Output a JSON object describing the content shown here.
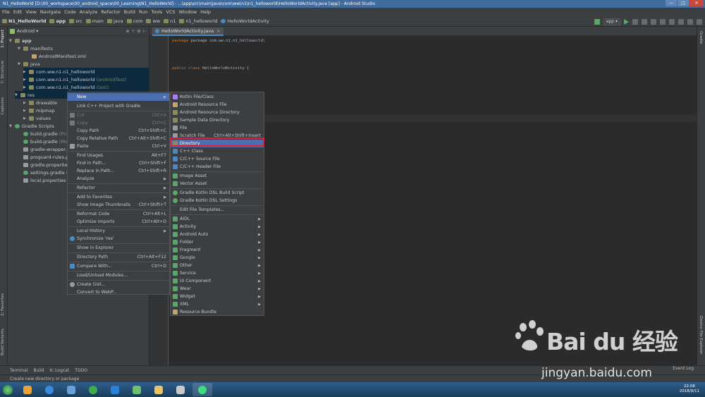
{
  "window": {
    "title": "N1_HelloWorld [D:\\00_workspace\\00_android_space\\00_Learning\\N1_HelloWorld] - ...\\app\\src\\main\\java\\com\\ww\\n1\\n1_helloworld\\HelloWorldActivity.java [app] - Android Studio",
    "controls": [
      "—",
      "□",
      "✕"
    ]
  },
  "menubar": [
    "File",
    "Edit",
    "View",
    "Navigate",
    "Code",
    "Analyze",
    "Refactor",
    "Build",
    "Run",
    "Tools",
    "VCS",
    "Window",
    "Help"
  ],
  "navbar": {
    "crumbs": [
      "N1_HelloWorld",
      "app",
      "src",
      "main",
      "java",
      "com",
      "ww",
      "n1",
      "n1_helloworld",
      "HelloWorldActivity"
    ],
    "run_config": "app"
  },
  "project": {
    "view": "Android",
    "tree": [
      {
        "label": "app"
      },
      {
        "label": "manifests"
      },
      {
        "label": "AndroidManifest.xml"
      },
      {
        "label": "java"
      },
      {
        "label": "com.ww.n1.n1_helloworld",
        "suffix": ""
      },
      {
        "label": "com.ww.n1.n1_helloworld",
        "suffix": "(androidTest)"
      },
      {
        "label": "com.ww.n1.n1_helloworld",
        "suffix": "(test)"
      },
      {
        "label": "res"
      },
      {
        "label": "drawable"
      },
      {
        "label": "mipmap"
      },
      {
        "label": "values"
      },
      {
        "label": "Gradle Scripts"
      },
      {
        "label": "build.gradle",
        "suffix": "(Proj"
      },
      {
        "label": "build.gradle",
        "suffix": "(Mo"
      },
      {
        "label": "gradle-wrapper.p"
      },
      {
        "label": "proguard-rules.p"
      },
      {
        "label": "gradle.properties"
      },
      {
        "label": "settings.gradle",
        "suffix": "(P"
      },
      {
        "label": "local.properties",
        "suffix": "("
      }
    ]
  },
  "left_tool_windows": [
    "1: Project",
    "7: Structure",
    "Captures",
    "2: Favorites",
    "Build Variants"
  ],
  "right_tool_windows": [
    "Gradle",
    "Device File Explorer"
  ],
  "editor": {
    "tab": "HelloWorldActivity.java",
    "lines": {
      "package": "package com.ww.n1.n1_helloworld;",
      "class_kw": "public class",
      "class_name": "HelloWorldActivity",
      "brace": "{",
      "close": "}"
    }
  },
  "context_menu": [
    {
      "label": "New",
      "shortcut": "",
      "submenu": true,
      "selected": true
    },
    {
      "label": "Link C++ Project with Gradle",
      "shortcut": ""
    },
    {
      "label": "Cut",
      "shortcut": "Ctrl+X",
      "disabled": true
    },
    {
      "label": "Copy",
      "shortcut": "Ctrl+C",
      "disabled": true
    },
    {
      "label": "Copy Path",
      "shortcut": "Ctrl+Shift+C"
    },
    {
      "label": "Copy Relative Path",
      "shortcut": "Ctrl+Alt+Shift+C"
    },
    {
      "label": "Paste",
      "shortcut": "Ctrl+V"
    },
    {
      "label": "Find Usages",
      "shortcut": "Alt+F7"
    },
    {
      "label": "Find in Path...",
      "shortcut": "Ctrl+Shift+F"
    },
    {
      "label": "Replace in Path...",
      "shortcut": "Ctrl+Shift+R"
    },
    {
      "label": "Analyze",
      "shortcut": "",
      "submenu": true
    },
    {
      "label": "Refactor",
      "shortcut": "",
      "submenu": true
    },
    {
      "label": "Add to Favorites",
      "shortcut": "",
      "submenu": true
    },
    {
      "label": "Show Image Thumbnails",
      "shortcut": "Ctrl+Shift+T"
    },
    {
      "label": "Reformat Code",
      "shortcut": "Ctrl+Alt+L"
    },
    {
      "label": "Optimize Imports",
      "shortcut": "Ctrl+Alt+O"
    },
    {
      "label": "Local History",
      "shortcut": "",
      "submenu": true
    },
    {
      "label": "Synchronize 'res'",
      "shortcut": ""
    },
    {
      "label": "Show in Explorer",
      "shortcut": ""
    },
    {
      "label": "Directory Path",
      "shortcut": "Ctrl+Alt+F12"
    },
    {
      "label": "Compare With...",
      "shortcut": "Ctrl+D"
    },
    {
      "label": "Load/Unload Modules...",
      "shortcut": ""
    },
    {
      "label": "Create Gist...",
      "shortcut": ""
    },
    {
      "label": "Convert to WebP...",
      "shortcut": ""
    }
  ],
  "new_submenu": [
    {
      "label": "Kotlin File/Class"
    },
    {
      "label": "Android Resource File"
    },
    {
      "label": "Android Resource Directory"
    },
    {
      "label": "Sample Data Directory"
    },
    {
      "label": "File"
    },
    {
      "label": "Scratch File",
      "shortcut": "Ctrl+Alt+Shift+Insert"
    },
    {
      "label": "Directory",
      "selected": true
    },
    {
      "label": "C++ Class"
    },
    {
      "label": "C/C++ Source File"
    },
    {
      "label": "C/C++ Header File"
    },
    {
      "label": "Image Asset"
    },
    {
      "label": "Vector Asset"
    },
    {
      "label": "Gradle Kotlin DSL Build Script"
    },
    {
      "label": "Gradle Kotlin DSL Settings"
    },
    {
      "label": "Edit File Templates..."
    },
    {
      "label": "AIDL",
      "submenu": true
    },
    {
      "label": "Activity",
      "submenu": true
    },
    {
      "label": "Android Auto",
      "submenu": true
    },
    {
      "label": "Folder",
      "submenu": true
    },
    {
      "label": "Fragment",
      "submenu": true
    },
    {
      "label": "Google",
      "submenu": true
    },
    {
      "label": "Other",
      "submenu": true
    },
    {
      "label": "Service",
      "submenu": true
    },
    {
      "label": "UI Component",
      "submenu": true
    },
    {
      "label": "Wear",
      "submenu": true
    },
    {
      "label": "Widget",
      "submenu": true
    },
    {
      "label": "XML",
      "submenu": true
    },
    {
      "label": "Resource Bundle"
    }
  ],
  "bottom_tabs": [
    "Terminal",
    "Build",
    "6: Logcat",
    "TODO"
  ],
  "event_log": "Event Log",
  "status": "Create new directory or package",
  "clock": {
    "time": "22:08",
    "date": "2018/9/11"
  },
  "watermark": {
    "logo": "Bai du 经验",
    "url": "jingyan.baidu.com"
  },
  "colors": {
    "selection": "#4b6eaf",
    "highlight_box": "#e0203a",
    "background": "#2b2b2b",
    "panel": "#3c3f41"
  }
}
